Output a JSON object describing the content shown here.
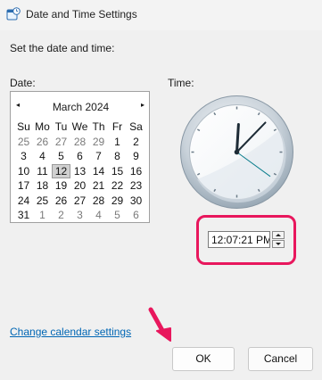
{
  "window": {
    "title": "Date and Time Settings",
    "app_icon": "date-time-settings-icon"
  },
  "heading": "Set the date and time:",
  "date": {
    "label": "Date:",
    "month_label": "March 2024",
    "prev_icon": "◂",
    "next_icon": "▸",
    "weekdays": [
      "Su",
      "Mo",
      "Tu",
      "We",
      "Th",
      "Fr",
      "Sa"
    ],
    "weeks": [
      [
        "25",
        "26",
        "27",
        "28",
        "29",
        "1",
        "2"
      ],
      [
        "3",
        "4",
        "5",
        "6",
        "7",
        "8",
        "9"
      ],
      [
        "10",
        "11",
        "12",
        "13",
        "14",
        "15",
        "16"
      ],
      [
        "17",
        "18",
        "19",
        "20",
        "21",
        "22",
        "23"
      ],
      [
        "24",
        "25",
        "26",
        "27",
        "28",
        "29",
        "30"
      ],
      [
        "31",
        "1",
        "2",
        "3",
        "4",
        "5",
        "6"
      ]
    ],
    "selected_day": "12"
  },
  "time": {
    "label": "Time:",
    "value": "12:07:21 PM",
    "clock_hours": 12,
    "clock_minutes": 7,
    "clock_seconds": 21
  },
  "link_change_calendar": "Change calendar settings",
  "buttons": {
    "ok": "OK",
    "cancel": "Cancel"
  },
  "colors": {
    "highlight": "#e8175d",
    "link": "#0066b4",
    "accent": "#0a7d8c"
  }
}
